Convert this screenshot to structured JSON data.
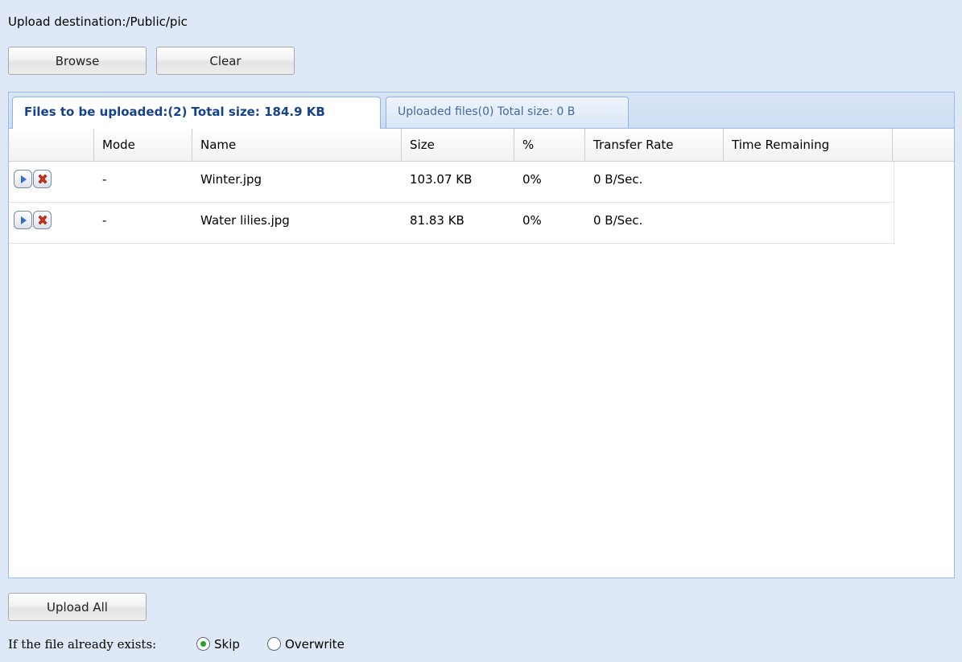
{
  "upload_destination": "Upload destination:/Public/pic",
  "toolbar": {
    "browse_label": "Browse",
    "clear_label": "Clear"
  },
  "tabs": [
    {
      "label": "Files to be uploaded:(2) Total size: 184.9 KB",
      "active": true
    },
    {
      "label": "Uploaded files(0) Total size: 0 B",
      "active": false
    }
  ],
  "table": {
    "columns": [
      "Mode",
      "Name",
      "Size",
      "%",
      "Transfer Rate",
      "Time Remaining"
    ],
    "rows": [
      {
        "mode": "-",
        "name": "Winter.jpg",
        "size": "103.07 KB",
        "percent": "0%",
        "transfer_rate": "0 B/Sec.",
        "time_remaining": ""
      },
      {
        "mode": "-",
        "name": "Water lilies.jpg",
        "size": "81.83 KB",
        "percent": "0%",
        "transfer_rate": "0 B/Sec.",
        "time_remaining": ""
      }
    ],
    "row_actions": [
      "play-icon",
      "delete-icon"
    ]
  },
  "upload_all_label": "Upload All",
  "exists_option": {
    "label": "If the file already exists:",
    "options": [
      {
        "label": "Skip",
        "selected": true
      },
      {
        "label": "Overwrite",
        "selected": false
      }
    ]
  },
  "colors": {
    "background": "#dfe8f6",
    "active_tab_text": "#15428b",
    "panel_border": "#99bbe8",
    "radio_selected": "#27a02c",
    "delete_icon": "#d2301a",
    "play_icon": "#2f6fc4"
  }
}
